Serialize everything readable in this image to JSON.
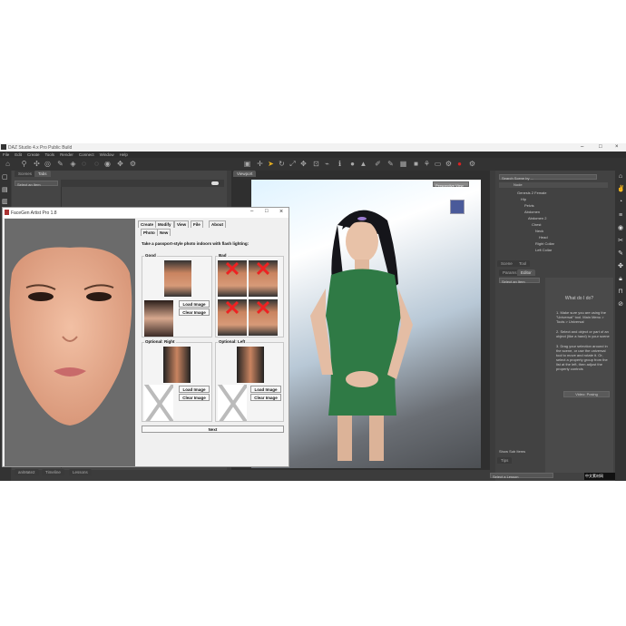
{
  "app": {
    "title": "DAZ Studio 4.x Pro Public Build",
    "menu": [
      "File",
      "Edit",
      "Create",
      "Tools",
      "Render",
      "Connect",
      "Window",
      "Help"
    ]
  },
  "left_panel": {
    "tabs": [
      "Scenes",
      "Tabs"
    ],
    "select": "Select an Item"
  },
  "viewport": {
    "tab": "Viewport",
    "camera": "Perspective View"
  },
  "scene": {
    "tabs": [
      "Scene",
      "Tool"
    ],
    "search": "Search Scene by ...",
    "header": "Node",
    "nodes": [
      "Genesis 2 Female",
      "Hip",
      "Pelvis",
      "Abdomen",
      "Abdomen 2",
      "Chest",
      "Neck",
      "Head",
      "Right Collar",
      "Left Collar"
    ]
  },
  "tool_panel": {
    "tabs": [
      "Params",
      "Editor"
    ],
    "select": "Select an Item",
    "heading": "What do I do?",
    "steps": [
      "1. Make sure you are using the \"Universal\" tool. Main Menu > Tools > Universal",
      "2. Select and object or part of an object (like a hand) in your scene",
      "3. Drag your selection around in the scene, or use the universal tool to move and rotate it. Or, select a property group from the list at the left, then adjust the property controls"
    ],
    "video_button": "Video: Posing",
    "show_sub": "Show Sub Items",
    "bottom_tab": "Tips",
    "bottom_select": "Select a Lesson"
  },
  "bottom_tabs": [
    "aniMate2",
    "Timeline",
    "Lessons"
  ],
  "facegen": {
    "title": "FaceGen Artist Pro 1.8",
    "tabs": [
      "Create",
      "Modify",
      "View",
      "File",
      "About"
    ],
    "subtabs": [
      "Photo",
      "New"
    ],
    "instruction": "Take a passport-style photo indoors with flash lighting:",
    "good": "Good",
    "bad": "Bad",
    "right": "Optional: Right",
    "left": "Optional: Left",
    "load": "Load Image",
    "clear": "Clear Image",
    "next": "Next"
  },
  "watermark": "中文素材网"
}
